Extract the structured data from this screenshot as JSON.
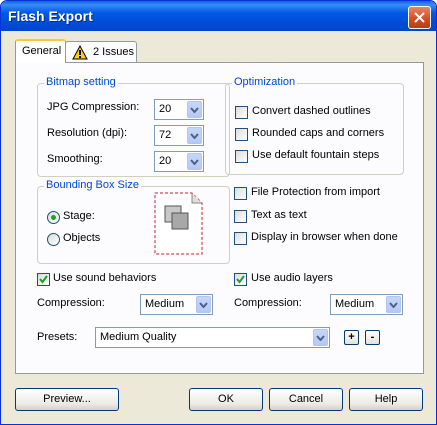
{
  "window": {
    "title": "Flash Export"
  },
  "tabs": [
    {
      "label": "General"
    },
    {
      "label": "2 Issues"
    }
  ],
  "bitmap": {
    "legend": "Bitmap setting",
    "jpg_label": "JPG Compression:",
    "jpg_value": "20",
    "res_label": "Resolution (dpi):",
    "res_value": "72",
    "smooth_label": "Smoothing:",
    "smooth_value": "20"
  },
  "optimization": {
    "legend": "Optimization",
    "items": [
      {
        "label": "Convert dashed outlines",
        "checked": false
      },
      {
        "label": "Rounded caps and corners",
        "checked": false
      },
      {
        "label": "Use default fountain steps",
        "checked": false
      }
    ]
  },
  "bbox": {
    "legend": "Bounding Box Size",
    "stage": "Stage:",
    "objects": "Objects",
    "selected": "stage"
  },
  "options": [
    {
      "label": "File Protection from import",
      "checked": false
    },
    {
      "label": "Text as text",
      "checked": false
    },
    {
      "label": "Display in browser when done",
      "checked": false
    }
  ],
  "sound": {
    "label": "Use sound behaviors",
    "checked": true,
    "compression_label": "Compression:",
    "compression_value": "Medium"
  },
  "audio": {
    "label": "Use audio layers",
    "checked": true,
    "compression_label": "Compression:",
    "compression_value": "Medium"
  },
  "presets": {
    "label": "Presets:",
    "value": "Medium Quality",
    "add": "+",
    "remove": "-"
  },
  "buttons": {
    "preview": "Preview...",
    "ok": "OK",
    "cancel": "Cancel",
    "help": "Help"
  }
}
